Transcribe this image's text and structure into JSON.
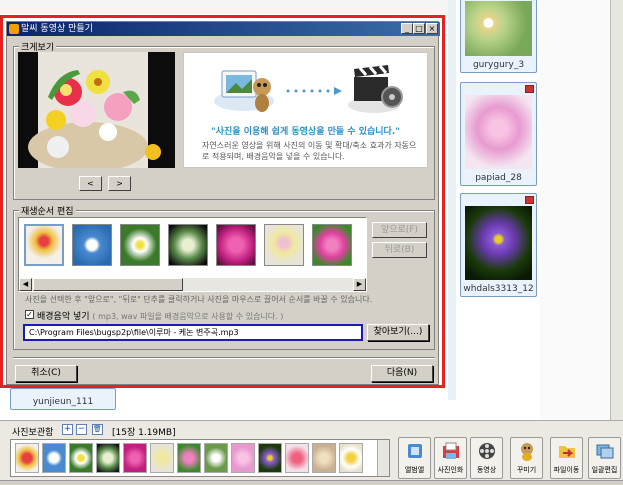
{
  "window": {
    "title": "말씨 동영상 만들기"
  },
  "preview_group": {
    "title": "크게보기",
    "headline": "\"사진을 이용해 쉽게 동영상을 만들 수 있습니다.\"",
    "description": "자연스러운 영상을 위해 사진의 이동 및 확대/축소 효과가 자동으로 적용되며, 배경음악을 넣을 수 있습니다.",
    "prev_label": "<",
    "next_label": ">"
  },
  "sequence_group": {
    "title": "재생순서 편집",
    "forward_label": "앞으로(F)",
    "back_label": "뒤로(B)",
    "hint": "사진을 선택한 후 \"앞으로\", \"뒤로\" 단추를 클릭하거나 사진을 마우스로 끌어서 순서를 바꿀 수 있습니다.",
    "music_checkbox_label": "배경음악 넣기",
    "music_checkbox_sub": "( mp3, wav 파일을 배경음악으로 사용할 수 있습니다. )",
    "music_checked": true,
    "music_path": "C:\\Program Files\\bugsp2p\\file\\이루마 - 케논 변주곡.mp3",
    "browse_label": "찾아보기(...)"
  },
  "dialog_buttons": {
    "cancel": "취소(C)",
    "next": "다음(N)"
  },
  "gallery": {
    "items": [
      {
        "caption": "gurygury_3"
      },
      {
        "caption": "papiad_28"
      },
      {
        "caption": "whdals3313_12"
      },
      {
        "caption": "yunjieun_111"
      }
    ]
  },
  "album": {
    "label": "사진보관함",
    "add_label": "+",
    "remove_label": "−",
    "delete_label": "🗑",
    "count": "[15장 1.19MB]"
  },
  "toolbar": {
    "buttons": [
      {
        "label": "앨범앨",
        "icon": "album-icon"
      },
      {
        "label": "사진인화",
        "icon": "print-photo-icon"
      },
      {
        "label": "동영상",
        "icon": "film-reel-icon"
      },
      {
        "label": "꾸미기",
        "icon": "decorate-icon"
      },
      {
        "label": "파일이동",
        "icon": "file-move-icon"
      },
      {
        "label": "일괄편집",
        "icon": "batch-edit-icon"
      }
    ]
  }
}
